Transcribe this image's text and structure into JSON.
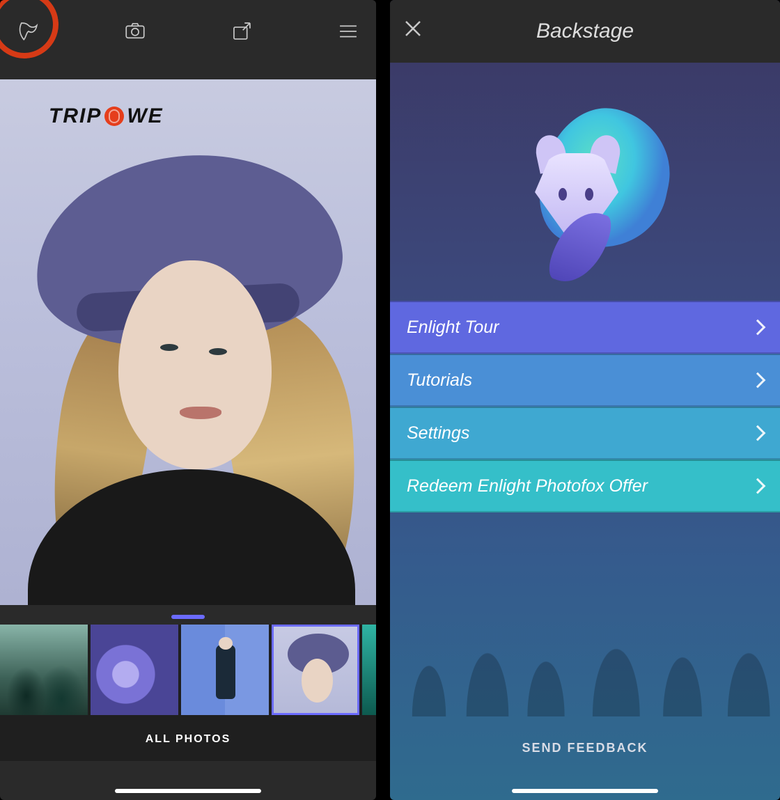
{
  "left": {
    "watermark_prefix": "TRIP",
    "watermark_suffix": "WE",
    "strip_label": "ALL PHOTOS",
    "thumbs": [
      {
        "name": "thumb-forest"
      },
      {
        "name": "thumb-flowers"
      },
      {
        "name": "thumb-man-blue"
      },
      {
        "name": "thumb-hat-portrait"
      },
      {
        "name": "thumb-pine"
      }
    ],
    "selected_thumb_index": 3
  },
  "right": {
    "title": "Backstage",
    "menu": [
      {
        "label": "Enlight Tour"
      },
      {
        "label": "Tutorials"
      },
      {
        "label": "Settings"
      },
      {
        "label": "Redeem Enlight Photofox Offer"
      }
    ],
    "feedback_label": "SEND FEEDBACK"
  },
  "colors": {
    "highlight": "#d63a16",
    "accent": "#6b6bff"
  }
}
